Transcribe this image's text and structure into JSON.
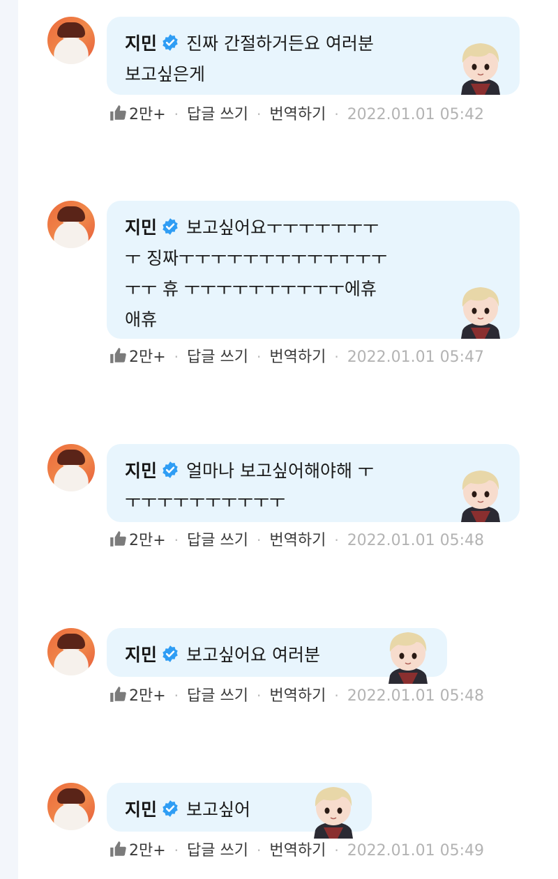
{
  "comments": [
    {
      "author": "지민",
      "lines": [
        "진짜 간절하거든요 여러분",
        "보고싶은게"
      ],
      "likes": "2만+",
      "reply_label": "답글 쓰기",
      "translate_label": "번역하기",
      "timestamp": "2022.01.01 05:42"
    },
    {
      "author": "지민",
      "lines": [
        "보고싶어요ㅜㅜㅜㅜㅜㅜㅜ",
        "ㅜ 징짜ㅜㅜㅜㅜㅜㅜㅜㅜㅜㅜㅜㅜㅜ",
        "ㅜㅜ 휴 ㅜㅜㅜㅜㅜㅜㅜㅜㅜㅜ에휴",
        "애휴"
      ],
      "likes": "2만+",
      "reply_label": "답글 쓰기",
      "translate_label": "번역하기",
      "timestamp": "2022.01.01 05:47"
    },
    {
      "author": "지민",
      "lines": [
        "얼마나 보고싶어해야해 ㅜ",
        "ㅜㅜㅜㅜㅜㅜㅜㅜㅜㅜ"
      ],
      "likes": "2만+",
      "reply_label": "답글 쓰기",
      "translate_label": "번역하기",
      "timestamp": "2022.01.01 05:48"
    },
    {
      "author": "지민",
      "lines": [
        "보고싶어요 여러분"
      ],
      "likes": "2만+",
      "reply_label": "답글 쓰기",
      "translate_label": "번역하기",
      "timestamp": "2022.01.01 05:48"
    },
    {
      "author": "지민",
      "lines": [
        "보고싶어"
      ],
      "likes": "2만+",
      "reply_label": "답글 쓰기",
      "translate_label": "번역하기",
      "timestamp": "2022.01.01 05:49"
    }
  ],
  "icons": {
    "verified": "verified-badge-icon",
    "like": "thumbs-up-icon"
  },
  "colors": {
    "bubble": "#e8f5fd",
    "verified": "#2f9df4",
    "timestamp": "#b3b3b3",
    "avatar_bg": "#ec6a3c"
  }
}
